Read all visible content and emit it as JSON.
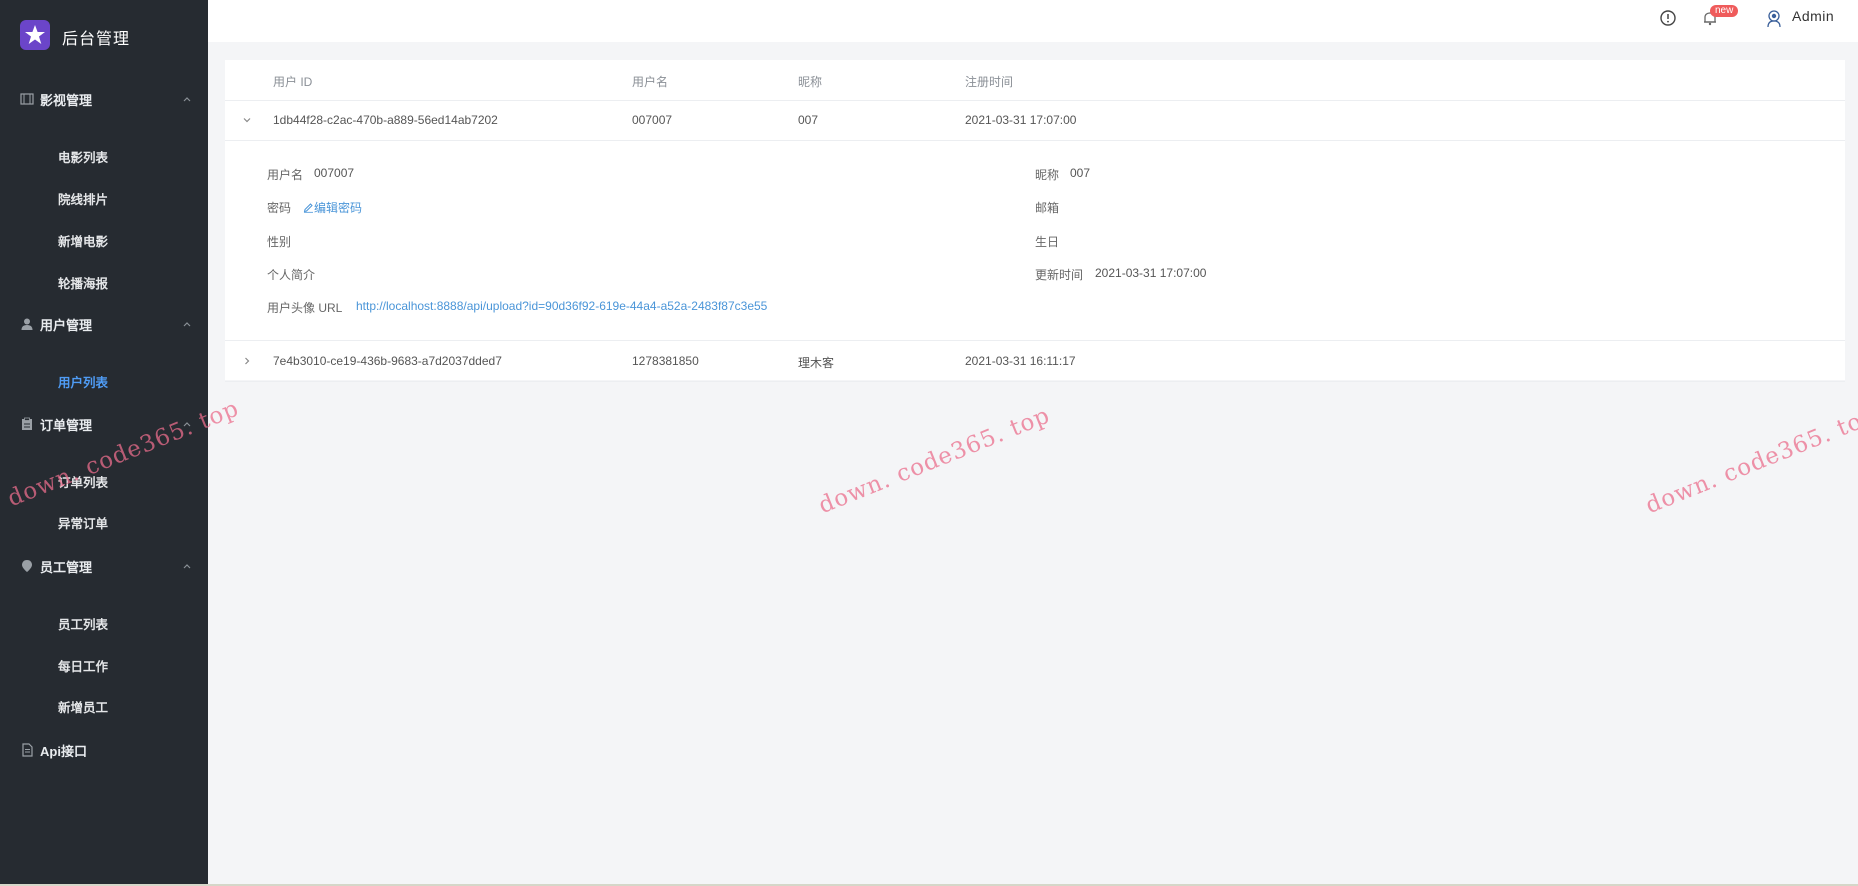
{
  "app": {
    "brand": "后台管理"
  },
  "sidebar": {
    "groups": [
      {
        "label": "影视管理",
        "icon": "film-icon",
        "items": [
          "电影列表",
          "院线排片",
          "新增电影",
          "轮播海报"
        ]
      },
      {
        "label": "用户管理",
        "icon": "user-icon",
        "items": [
          "用户列表"
        ]
      },
      {
        "label": "订单管理",
        "icon": "clipboard-icon",
        "items": [
          "订单列表",
          "异常订单"
        ]
      },
      {
        "label": "员工管理",
        "icon": "location-pin-icon",
        "items": [
          "员工列表",
          "每日工作",
          "新增员工"
        ]
      },
      {
        "label": "Api接口",
        "icon": "document-icon",
        "items": []
      }
    ],
    "active_item": "用户列表"
  },
  "header": {
    "badge": "new",
    "user": "Admin"
  },
  "table": {
    "columns": [
      "用户 ID",
      "用户名",
      "昵称",
      "注册时间"
    ],
    "rows": [
      {
        "id": "1db44f28-c2ac-470b-a889-56ed14ab7202",
        "username": "007007",
        "nickname": "007",
        "registered": "2021-03-31 17:07:00",
        "expanded": true
      },
      {
        "id": "7e4b3010-ce19-436b-9683-a7d2037dded7",
        "username": "1278381850",
        "nickname": "理木客",
        "registered": "2021-03-31 16:11:17",
        "expanded": false
      }
    ],
    "detail": {
      "username_label": "用户名",
      "username": "007007",
      "nickname_label": "昵称",
      "nickname": "007",
      "password_label": "密码",
      "edit_password": "编辑密码",
      "email_label": "邮箱",
      "gender_label": "性别",
      "birthday_label": "生日",
      "bio_label": "个人简介",
      "updated_label": "更新时间",
      "updated": "2021-03-31 17:07:00",
      "avatar_label": "用户头像 URL",
      "avatar_url": "http://localhost:8888/api/upload?id=90d36f92-619e-44a4-a52a-2483f87c3e55"
    }
  },
  "watermark": "down. code365. top",
  "colors": {
    "sidebar": "#262b31",
    "active": "#4f9cf5",
    "link": "#4a95d8",
    "badge": "#ef5b5b",
    "brand_logo": "#6b45c9"
  }
}
